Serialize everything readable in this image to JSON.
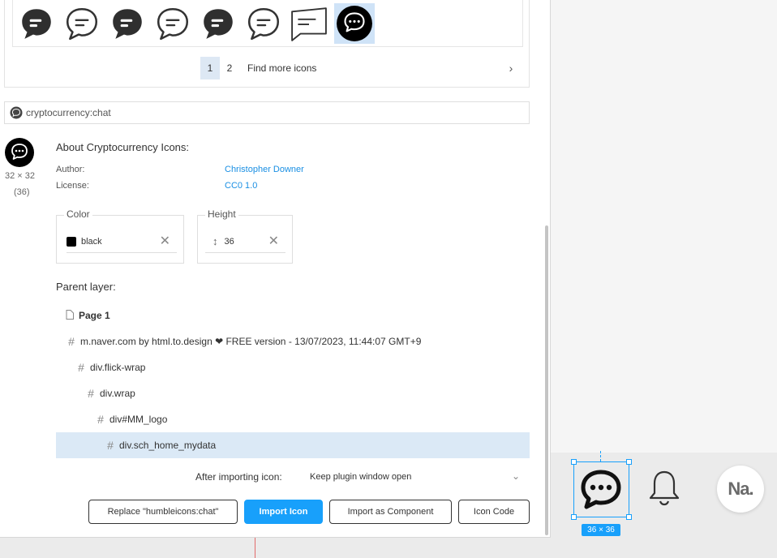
{
  "icon_grid": {
    "icons": [
      {
        "name": "chat-filled-icon"
      },
      {
        "name": "chat-outline-icon"
      },
      {
        "name": "chat-filled-icon"
      },
      {
        "name": "chat-outline-icon"
      },
      {
        "name": "chat-filled-icon"
      },
      {
        "name": "chat-outline-icon"
      },
      {
        "name": "chat-square-outline-icon"
      },
      {
        "name": "chat-dots-icon",
        "selected": true
      }
    ],
    "pages": [
      "1",
      "2"
    ],
    "active_page": "1",
    "find_more": "Find more icons",
    "next": "›"
  },
  "icon_name": "cryptocurrency:chat",
  "preview": {
    "size": "32 × 32",
    "count": "(36)"
  },
  "about": {
    "title": "About Cryptocurrency Icons:",
    "author_label": "Author:",
    "author": "Christopher Downer",
    "license_label": "License:",
    "license": "CC0 1.0"
  },
  "color_field": {
    "legend": "Color",
    "value": "black",
    "swatch": "#000000"
  },
  "height_field": {
    "legend": "Height",
    "value": "36",
    "icon": "↕"
  },
  "parent": {
    "title": "Parent layer:",
    "layers": [
      {
        "glyph": "page",
        "label": "Page 1"
      },
      {
        "glyph": "#",
        "label": "m.naver.com by html.to.design ❤ FREE version - 13/07/2023, 11:44:07 GMT+9"
      },
      {
        "glyph": "#",
        "label": "div.flick-wrap"
      },
      {
        "glyph": "#",
        "label": "div.wrap"
      },
      {
        "glyph": "#",
        "label": "div#MM_logo"
      },
      {
        "glyph": "#",
        "label": "div.sch_home_mydata",
        "selected": true
      }
    ]
  },
  "after_import": {
    "label": "After importing icon:",
    "value": "Keep plugin window open"
  },
  "buttons": {
    "replace": "Replace \"humbleicons:chat\"",
    "import": "Import Icon",
    "import_component": "Import as Component",
    "icon_code": "Icon Code"
  },
  "canvas": {
    "selection_size": "36 × 36",
    "naver_badge": "Na."
  },
  "colors": {
    "accent": "#18a0fb",
    "link": "#1a8fe3",
    "selected_row": "#dbe9f6"
  }
}
